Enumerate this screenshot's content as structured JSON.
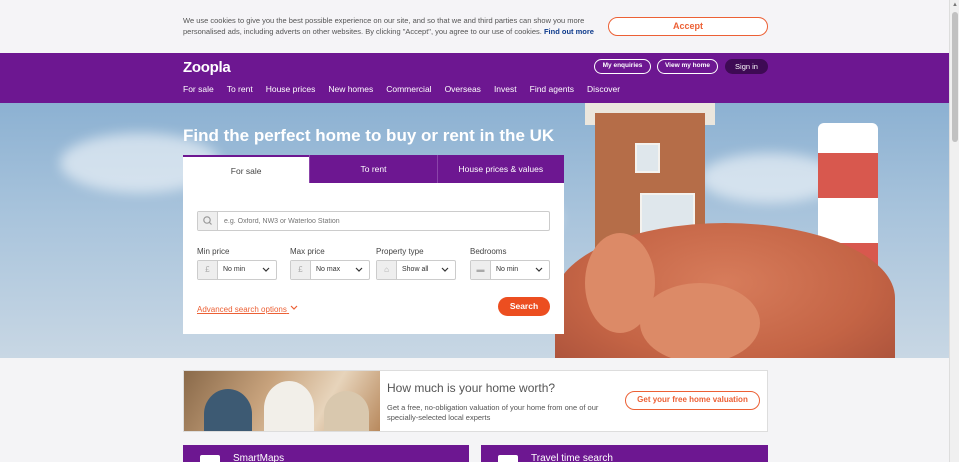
{
  "cookie": {
    "text": "We use cookies to give you the best possible experience on our site, and so that we and third parties can show you more personalised ads, including adverts on other websites. By clicking \"Accept\", you agree to our use of cookies.",
    "link": "Find out more",
    "accept_label": "Accept"
  },
  "header": {
    "logo": "Zoopla",
    "enquiries_label": "My enquiries",
    "view_home_label": "View my home",
    "signin_label": "Sign in",
    "nav": [
      "For sale",
      "To rent",
      "House prices",
      "New homes",
      "Commercial",
      "Overseas",
      "Invest",
      "Find agents",
      "Discover"
    ]
  },
  "hero": {
    "title": "Find the perfect home to buy or rent in the UK"
  },
  "search": {
    "tabs": [
      "For sale",
      "To rent",
      "House prices & values"
    ],
    "placeholder": "e.g. Oxford, NW3 or Waterloo Station",
    "filters": [
      {
        "label": "Min price",
        "prefix": "£",
        "value": "No min"
      },
      {
        "label": "Max price",
        "prefix": "£",
        "value": "No max"
      },
      {
        "label": "Property type",
        "prefix": "⌂",
        "value": "Show all"
      },
      {
        "label": "Bedrooms",
        "prefix": "▬",
        "value": "No min"
      }
    ],
    "advanced_label": "Advanced search options",
    "search_label": "Search"
  },
  "valuation": {
    "title": "How much is your home worth?",
    "description": "Get a free, no-obligation valuation of your home from one of our specially-selected local experts",
    "button_label": "Get your free home valuation"
  },
  "promos": [
    {
      "title": "SmartMaps"
    },
    {
      "title": "Travel time search"
    }
  ],
  "colors": {
    "brand_purple": "#6d1791",
    "accent_orange": "#ec6035"
  }
}
